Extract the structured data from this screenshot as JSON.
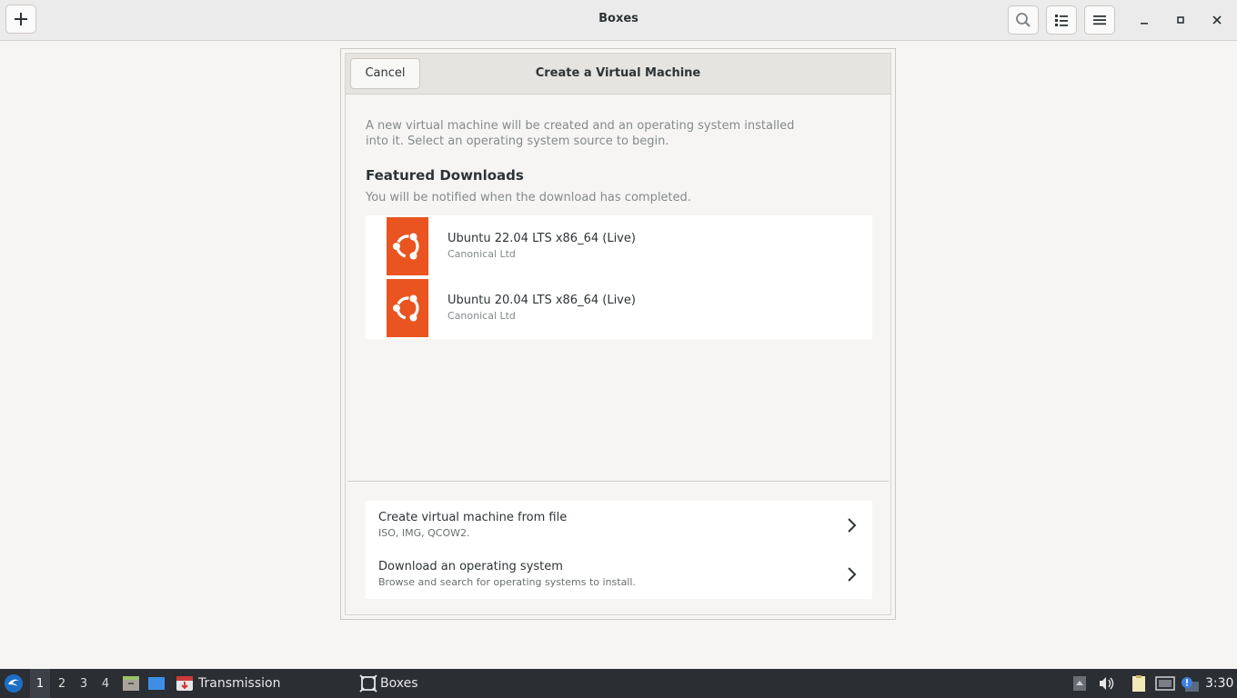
{
  "window": {
    "title": "Boxes"
  },
  "header_icons": {
    "new": "plus-icon",
    "search": "search-icon",
    "view": "list-view-icon",
    "menu": "hamburger-menu-icon",
    "minimize": "minimize-icon",
    "maximize": "maximize-icon",
    "close": "close-icon"
  },
  "dialog": {
    "title": "Create a Virtual Machine",
    "cancel_label": "Cancel",
    "intro": "A new virtual machine will be created and an operating system installed into it. Select an operating system source to begin.",
    "featured": {
      "title": "Featured Downloads",
      "subtitle": "You will be notified when the download has completed.",
      "items": [
        {
          "name": "Ubuntu 22.04 LTS x86_64 (Live)",
          "vendor": "Canonical Ltd",
          "icon": "ubuntu-logo-icon"
        },
        {
          "name": "Ubuntu 20.04 LTS x86_64 (Live)",
          "vendor": "Canonical Ltd",
          "icon": "ubuntu-logo-icon"
        }
      ]
    },
    "actions": [
      {
        "title": "Create virtual machine from file",
        "subtitle": "ISO, IMG, QCOW2."
      },
      {
        "title": "Download an operating system",
        "subtitle": "Browse and search for operating systems to install."
      }
    ]
  },
  "taskbar": {
    "workspaces": [
      "1",
      "2",
      "3",
      "4"
    ],
    "active_workspace": "1",
    "tasks": [
      {
        "label": "Transmission",
        "icon": "transmission-icon"
      },
      {
        "label": "Boxes",
        "icon": "boxes-icon"
      }
    ],
    "clock": "3:30"
  },
  "colors": {
    "ubuntu_orange": "#e95420",
    "taskbar_bg": "#2b2e33"
  }
}
